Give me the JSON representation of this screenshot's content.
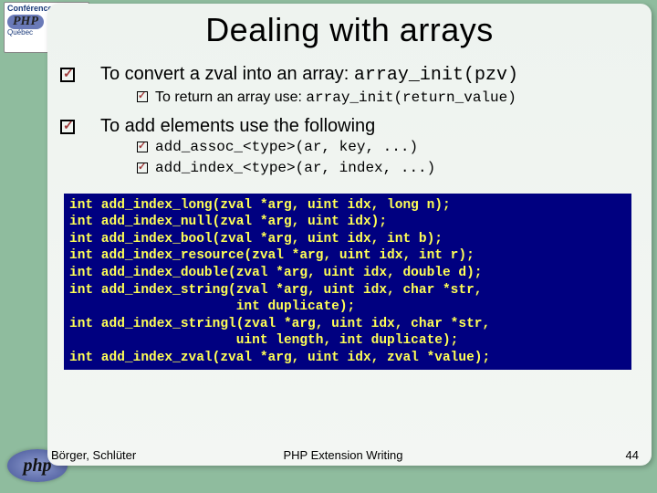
{
  "title": "Dealing with arrays",
  "b1": {
    "text_a": "To convert a zval into an array: ",
    "code": "array_init(pzv)",
    "sub1_a": "To return an array use: ",
    "sub1_code": "array_init(return_value)"
  },
  "b2": {
    "text": "To add elements use the following",
    "sub1": "add_assoc_<type>(ar, key, ...)",
    "sub2": "add_index_<type>(ar, index, ...)"
  },
  "code": "int add_index_long(zval *arg, uint idx, long n);\nint add_index_null(zval *arg, uint idx);\nint add_index_bool(zval *arg, uint idx, int b);\nint add_index_resource(zval *arg, uint idx, int r);\nint add_index_double(zval *arg, uint idx, double d);\nint add_index_string(zval *arg, uint idx, char *str,\n                     int duplicate);\nint add_index_stringl(zval *arg, uint idx, char *str,\n                     uint length, int duplicate);\nint add_index_zval(zval *arg, uint idx, zval *value);",
  "footer": {
    "left": "Börger, Schlüter",
    "center": "PHP Extension Writing",
    "right": "44"
  },
  "logo": {
    "conf": "Conférence",
    "qc": "Québec",
    "php": "PHP",
    "php2": "php"
  }
}
